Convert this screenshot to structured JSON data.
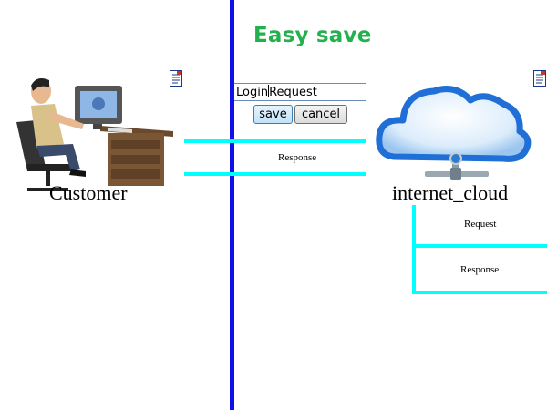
{
  "title": "Easy save",
  "login": {
    "value_before_caret": "Login",
    "value_after_caret": "Request"
  },
  "buttons": {
    "save": "save",
    "cancel": "cancel"
  },
  "customer": {
    "label": "Customer"
  },
  "cloud": {
    "label": "internet_cloud"
  },
  "connections": {
    "left_response": "Response",
    "right_request": "Request",
    "right_response": "Response"
  },
  "icons": {
    "customer_doc": "document-icon",
    "cloud_doc": "document-icon"
  },
  "colors": {
    "lifeline": "#1010e8",
    "connector": "#00ffff",
    "title": "#22b14c"
  }
}
